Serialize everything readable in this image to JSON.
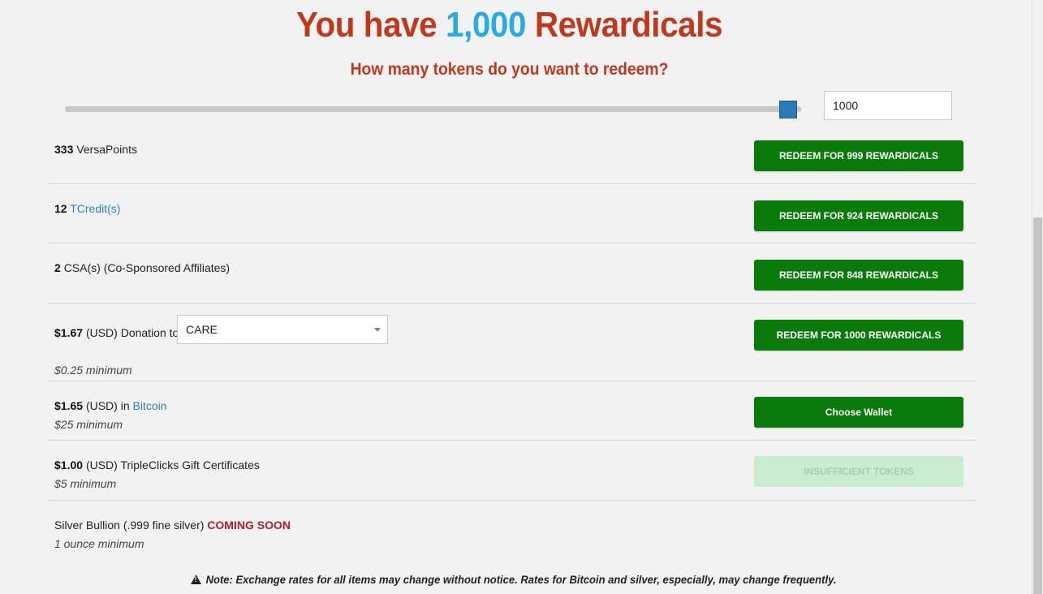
{
  "header": {
    "title_prefix": "You have",
    "title_amount": "1,000",
    "title_suffix": "Rewardicals",
    "subtitle": "How many tokens do you want to redeem?"
  },
  "slider": {
    "value": 1000,
    "fraction": 1.0
  },
  "amount_input": {
    "value": "1000"
  },
  "rows": [
    {
      "qty": "333",
      "label": "VersaPoints",
      "button": "REDEEM FOR 999 REWARDICALS"
    },
    {
      "qty": "12",
      "link": "TCredit(s)",
      "button": "REDEEM FOR 924 REWARDICALS"
    },
    {
      "qty": "2",
      "label": "CSA(s) (Co-Sponsored Affiliates)",
      "button": "REDEEM FOR 848 REWARDICALS"
    },
    {
      "qty": "$1.67",
      "label": "(USD) Donation to",
      "select_value": "CARE",
      "minimum": "$0.25 minimum",
      "button": "REDEEM FOR 1000 REWARDICALS"
    },
    {
      "qty": "$1.65",
      "label": "(USD) in",
      "link": "Bitcoin",
      "minimum": "$25 minimum",
      "button": "Choose Wallet"
    },
    {
      "qty": "$1.00",
      "label": "(USD) TripleClicks Gift Certificates",
      "minimum": "$5 minimum",
      "button": "INSUFFICIENT TOKENS"
    },
    {
      "label": "Silver Bullion (.999 fine silver)",
      "status": "COMING SOON",
      "minimum": "1 ounce minimum"
    }
  ],
  "note": "Note: Exchange rates for all items may change without notice. Rates for Bitcoin and silver, especially, may change frequently.",
  "colors": {
    "title_red": "#c0391f",
    "title_blue": "#29abe2",
    "button_green": "#0a7a0a",
    "button_disabled": "#c9ecd1",
    "link_blue": "#2f7fc1",
    "coming_soon_red": "#b0202a",
    "slider_thumb": "#2a7ab8"
  },
  "icons": {
    "warning": "warning-triangle-icon",
    "select_caret": "chevron-down-icon"
  }
}
